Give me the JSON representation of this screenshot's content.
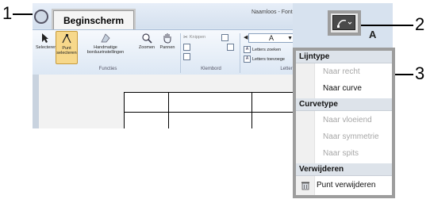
{
  "window": {
    "title": "Naamloos - Font Creator",
    "tab_label": "Beginscherm"
  },
  "ribbon": {
    "buttons": {
      "selecteren": "Selecteren",
      "punt_selecteren_1": "Punt",
      "punt_selecteren_2": "selecteren",
      "handmatige_1": "Handmatige",
      "handmatige_2": "borduurinstellingen",
      "zoomen": "Zoomen",
      "pannen": "Pannen"
    },
    "clipboard": {
      "knippen": "Knippen",
      "plakken": "",
      "kopieren": ""
    },
    "letters": {
      "font_value": "A",
      "letters_zoeken": "Letters zoeken",
      "letters_toevoegen": "Letters toevoege"
    },
    "groups": {
      "functies": "Functies",
      "klembord": "Klembord",
      "letter": "Letter"
    }
  },
  "menu": {
    "sections": [
      {
        "header": "Lijntype",
        "items": [
          {
            "label": "Naar recht",
            "enabled": false
          },
          {
            "label": "Naar curve",
            "enabled": true
          }
        ]
      },
      {
        "header": "Curvetype",
        "items": [
          {
            "label": "Naar vloeiend",
            "enabled": false
          },
          {
            "label": "Naar symmetrie",
            "enabled": false
          },
          {
            "label": "Naar spits",
            "enabled": false
          }
        ]
      },
      {
        "header": "Verwijderen",
        "items": [
          {
            "label": "Punt verwijderen",
            "enabled": true,
            "icon": "trash-icon"
          }
        ]
      }
    ]
  },
  "preview_letter": "A",
  "callouts": {
    "one": "1",
    "two": "2",
    "three": "3"
  },
  "colors": {
    "ribbon_bg": "#dce7f4",
    "active_button": "#f7d88b",
    "highlight_frame": "#9d9d9d",
    "menu_header": "#dde3ea",
    "disabled_text": "#a7a7a7"
  }
}
